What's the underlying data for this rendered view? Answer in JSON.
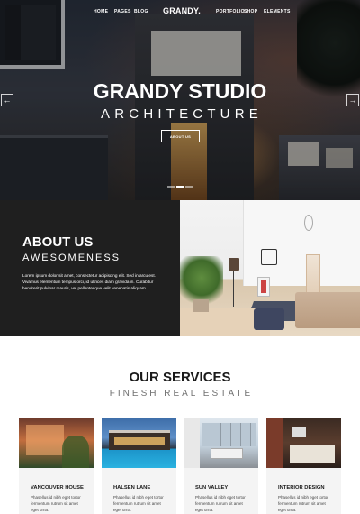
{
  "nav": {
    "links_left": [
      "HOME",
      "PAGES",
      "BLOG"
    ],
    "brand": "GRANDY.",
    "links_right": [
      "PORTFOLIO",
      "SHOP",
      "ELEMENTS"
    ]
  },
  "hero": {
    "title": "GRANDY STUDIO",
    "subtitle": "ARCHITECTURE",
    "button": "ABOUT US",
    "prev_arrow": "←",
    "next_arrow": "→",
    "slides": 3,
    "active_slide": 1
  },
  "about": {
    "title": "ABOUT US",
    "subtitle": "AWESOMENESS",
    "text": "Lorem ipsum dolor sit amet, consectetur adipiscing elit. Sed in arcu est. Vivamus elementum tempus orci, id ultrices diam gravida in. Curabitur hendrerit pulvinar mauris, vel pellentesque velit venenatis aliquam."
  },
  "services": {
    "title": "OUR SERVICES",
    "subtitle": "FINESH REAL ESTATE",
    "cards": [
      {
        "title": "VANCOUVER HOUSE",
        "text": "Phasellus id nibh eget tortor fermentum rutrum sit amet eget urna."
      },
      {
        "title": "HALSEN LANE",
        "text": "Phasellus id nibh eget tortor fermentum rutrum sit amet eget urna."
      },
      {
        "title": "SUN VALLEY",
        "text": "Phasellus id nibh eget tortor fermentum rutrum sit amet eget urna."
      },
      {
        "title": "INTERIOR DESIGN",
        "text": "Phasellus id nibh eget tortor fermentum rutrum sit amet eget urna."
      }
    ]
  }
}
